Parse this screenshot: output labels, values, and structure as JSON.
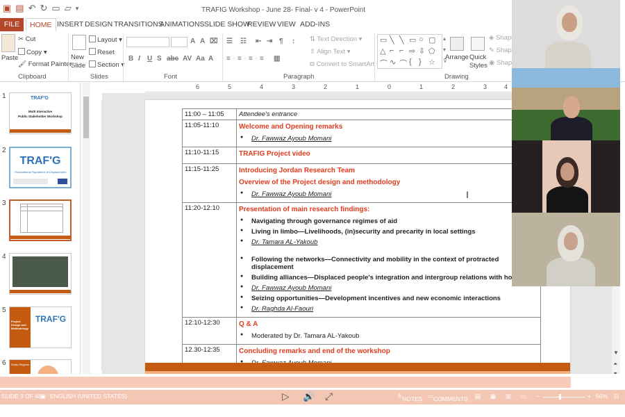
{
  "window": {
    "title": "TRAFIG Workshop - June 28- Final- v 4 - PowerPoint"
  },
  "tabs": [
    "FILE",
    "HOME",
    "INSERT",
    "DESIGN",
    "TRANSITIONS",
    "ANIMATIONS",
    "SLIDE SHOW",
    "REVIEW",
    "VIEW",
    "ADD-INS"
  ],
  "ribbon": {
    "clipboard": {
      "label": "Clipboard",
      "paste": "Paste",
      "cut": "Cut",
      "copy": "Copy",
      "format_painter": "Format Painter"
    },
    "slides": {
      "label": "Slides",
      "new_slide": "New Slide",
      "layout": "Layout",
      "reset": "Reset",
      "section": "Section"
    },
    "font": {
      "label": "Font"
    },
    "paragraph": {
      "label": "Paragraph",
      "text_direction": "Text Direction",
      "align_text": "Align Text",
      "smartart": "Convert to SmartArt"
    },
    "drawing": {
      "label": "Drawing",
      "arrange": "Arrange",
      "quick_styles": "Quick Styles",
      "shape1": "Shape",
      "shape2": "Shape",
      "shape3": "Shape"
    }
  },
  "ruler": {
    "h": [
      "6",
      "5",
      "4",
      "3",
      "2",
      "1",
      "0",
      "1",
      "2",
      "3",
      "4"
    ]
  },
  "thumbnails": [
    {
      "num": "1",
      "title": "TRAF'G",
      "lines": [
        "Multi Interactive",
        "Public Stakeholder Workshop"
      ]
    },
    {
      "num": "2",
      "title": "TRAF'G",
      "lines": [
        "Transnational Figurations of Displacement"
      ]
    },
    {
      "num": "3",
      "title": "",
      "lines": []
    },
    {
      "num": "4",
      "title": "",
      "lines": []
    },
    {
      "num": "5",
      "title": "TRAF'G",
      "lines": [
        "Project Design and Methodology"
      ]
    },
    {
      "num": "6",
      "title": "",
      "lines": [
        "Study Regions"
      ]
    }
  ],
  "agenda": [
    {
      "time": "11:00 – 11:05",
      "content": [
        {
          "k": "it",
          "text": "Attendee's entrance"
        }
      ]
    },
    {
      "time": "11:05-11:10",
      "content": [
        {
          "k": "red",
          "text": "Welcome and Opening remarks"
        },
        {
          "k": "bul-i",
          "text": "Dr. Fawwaz Ayoub  Momani"
        }
      ]
    },
    {
      "time": "11:10-11:15",
      "content": [
        {
          "k": "red",
          "text": "TRAFIG Project video"
        }
      ]
    },
    {
      "time": "11:15-11:25",
      "content": [
        {
          "k": "red",
          "text": "Introducing Jordan Research Team"
        },
        {
          "k": "red",
          "text": "Overview of the Project design and methodology"
        },
        {
          "k": "bul-i",
          "text": "Dr. Fawwaz Ayoub  Momani"
        }
      ]
    },
    {
      "time": "11:20-12:10",
      "content": [
        {
          "k": "red",
          "text": "Presentation of main research findings:"
        },
        {
          "k": "bul-b",
          "text": "Navigating through governance regimes of aid"
        },
        {
          "k": "bul-b",
          "text": "Living in limbo—Livelihoods, (in)security and precarity in local settings"
        },
        {
          "k": "bul-i",
          "text": "Dr. Tamara AL-Yakoub"
        },
        {
          "k": "gap",
          "text": ""
        },
        {
          "k": "bul-b",
          "text": "Following the networks—Connectivity and mobility in the context of protracted displacement"
        },
        {
          "k": "bul-b",
          "text": "Building alliances—Displaced people's integration and intergroup relations with hosts"
        },
        {
          "k": "bul-i",
          "text": "Dr. Fawwaz Ayoub  Momani"
        },
        {
          "k": "bul-b",
          "text": "Seizing opportunities—Development incentives and new economic interactions"
        },
        {
          "k": "bul-i",
          "text": "Dr. Raghda Al-Faouri"
        }
      ]
    },
    {
      "time": "12:10-12:30",
      "content": [
        {
          "k": "red",
          "text": "Q & A"
        },
        {
          "k": "bul",
          "text": "Moderated by Dr. Tamara AL-Yakoub"
        }
      ]
    },
    {
      "time": "12.30-12:35",
      "content": [
        {
          "k": "red",
          "text": "Concluding remarks and end of the workshop"
        },
        {
          "k": "bul-i",
          "text": "Dr. Fawwaz Ayoub  Momani"
        }
      ]
    }
  ],
  "status": {
    "slide": "SLIDE 3 OF 48",
    "language": "ENGLISH (UNITED STATES)",
    "notes": "NOTES",
    "comments": "COMMENTS",
    "zoom": "66%"
  },
  "colors": {
    "accent": "#b7472a",
    "slide_bar": "#c55a11",
    "heading_red": "#e03c1e"
  }
}
